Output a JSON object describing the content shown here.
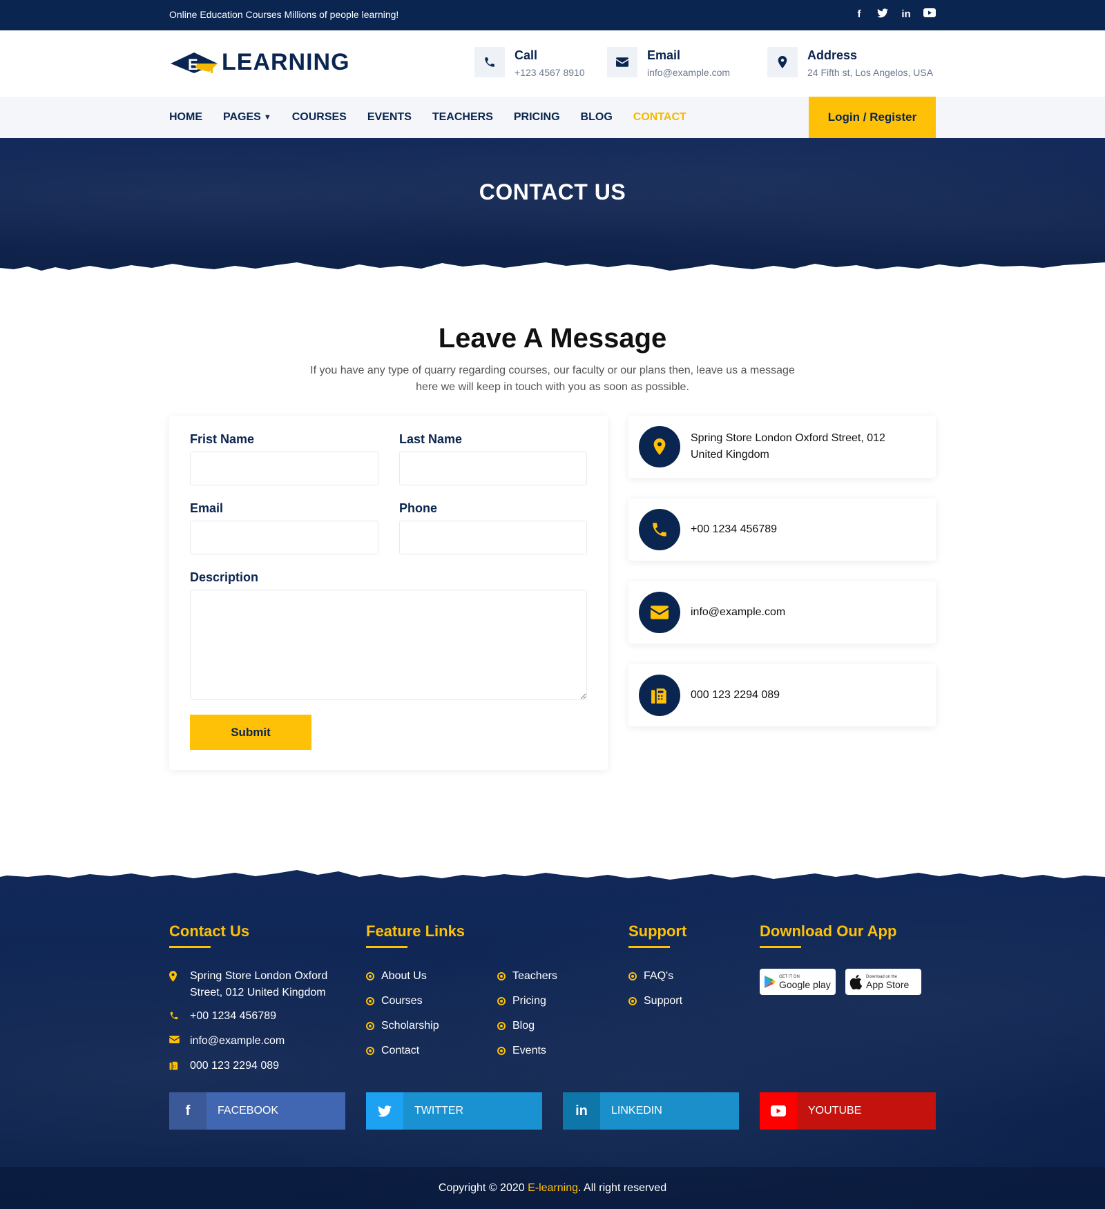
{
  "topbar": {
    "tagline": "Online Education Courses Millions of people learning!",
    "socials": [
      "facebook-icon",
      "twitter-icon",
      "linkedin-icon",
      "youtube-icon"
    ]
  },
  "header": {
    "logo_text": "LEARNING",
    "logo_letter": "E",
    "call": {
      "title": "Call",
      "value": "+123 4567 8910"
    },
    "email": {
      "title": "Email",
      "value": "info@example.com"
    },
    "address": {
      "title": "Address",
      "value": "24 Fifth st, Los Angelos, USA"
    }
  },
  "nav": {
    "items": [
      {
        "label": "HOME"
      },
      {
        "label": "PAGES"
      },
      {
        "label": "COURSES"
      },
      {
        "label": "EVENTS"
      },
      {
        "label": "TEACHERS"
      },
      {
        "label": "PRICING"
      },
      {
        "label": "BLOG"
      },
      {
        "label": "CONTACT"
      }
    ],
    "active": "CONTACT",
    "login_label": "Login / Register"
  },
  "hero": {
    "title": "CONTACT US"
  },
  "message": {
    "title": "Leave A Message",
    "subtitle": "If you have any type of quarry regarding courses, our faculty or our plans then, leave us a message here we will keep in touch with you as soon as possible."
  },
  "form": {
    "first_name_label": "Frist Name",
    "last_name_label": "Last Name",
    "email_label": "Email",
    "phone_label": "Phone",
    "description_label": "Description",
    "first_name_value": "",
    "last_name_value": "",
    "email_value": "",
    "phone_value": "",
    "description_value": "",
    "submit_label": "Submit"
  },
  "contact_cards": [
    {
      "icon": "map-pin-icon",
      "text": "Spring Store London Oxford Street, 012 United Kingdom"
    },
    {
      "icon": "phone-icon",
      "text": "+00 1234 456789"
    },
    {
      "icon": "envelope-icon",
      "text": "info@example.com"
    },
    {
      "icon": "fax-icon",
      "text": "000 123 2294 089"
    }
  ],
  "footer": {
    "contact": {
      "title": "Contact Us",
      "address": "Spring Store London Oxford Street, 012 United Kingdom",
      "phone": "+00 1234 456789",
      "email": "info@example.com",
      "fax": "000 123 2294 089"
    },
    "feature_links": {
      "title": "Feature Links",
      "col1": [
        "About Us",
        "Courses",
        "Scholarship",
        "Contact"
      ],
      "col2": [
        "Teachers",
        "Pricing",
        "Blog",
        "Events"
      ]
    },
    "support": {
      "title": "Support",
      "items": [
        "FAQ's",
        "Support"
      ]
    },
    "app": {
      "title": "Download Our App",
      "google": {
        "small": "GET IT ON",
        "big": "Google play"
      },
      "apple": {
        "small": "Download on the",
        "big": "App Store"
      }
    },
    "social_buttons": [
      {
        "label": "FACEBOOK",
        "color": "#4267b2",
        "icon_bg": "#3b5998"
      },
      {
        "label": "TWITTER",
        "color": "#1a91d0",
        "icon_bg": "#1da1f2"
      },
      {
        "label": "LINKEDIN",
        "color": "#1a8fc9",
        "icon_bg": "#0e76a8"
      },
      {
        "label": "YOUTUBE",
        "color": "#c4120f",
        "icon_bg": "#ff0000"
      }
    ],
    "copyright_prefix": "Copyright © 2020 ",
    "copyright_brand": "E-learning",
    "copyright_suffix": ". All right reserved"
  },
  "colors": {
    "navy": "#0a2550",
    "accent": "#ffc107"
  }
}
